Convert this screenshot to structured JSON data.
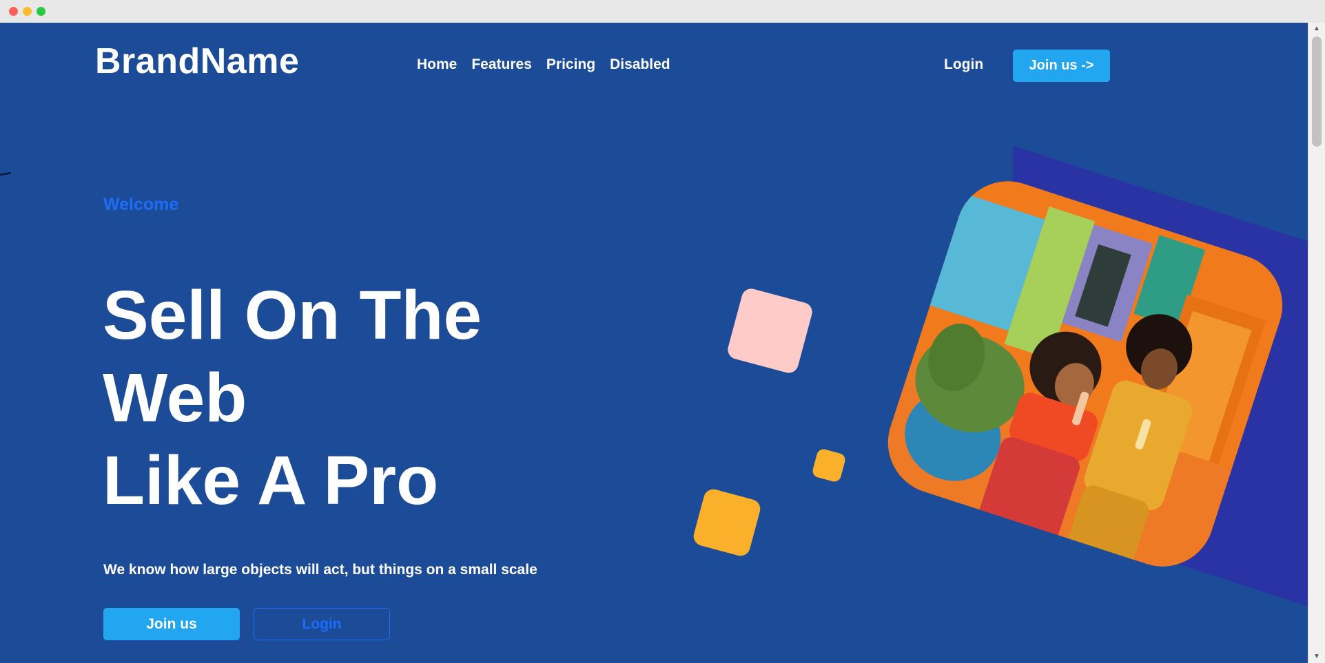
{
  "window": {
    "controls": [
      "close",
      "minimize",
      "maximize"
    ]
  },
  "header": {
    "brand": "BrandName",
    "nav": [
      {
        "label": "Home"
      },
      {
        "label": "Features"
      },
      {
        "label": "Pricing"
      },
      {
        "label": "Disabled"
      }
    ],
    "login_label": "Login",
    "join_label": "Join us ->"
  },
  "hero": {
    "eyebrow": "Welcome",
    "headline_lines": [
      "Sell On The",
      "Web",
      "Like A Pro"
    ],
    "subtitle": "We know how large objects will act, but things on a small scale",
    "primary_button": "Join us",
    "secondary_button": "Login"
  },
  "colors": {
    "page_background": "#1c4b98",
    "accent_blue": "#23a6f0",
    "link_blue": "#1c6dfc",
    "panel_indigo": "#2a33a3",
    "pink_square": "#ffcbc9",
    "yellow_square": "#fbb02b"
  },
  "image": {
    "description_icon": "photo-illustration"
  }
}
